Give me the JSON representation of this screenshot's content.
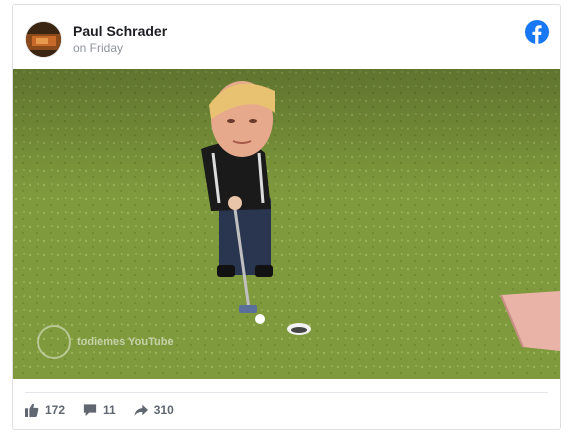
{
  "post": {
    "author": "Paul Schrader",
    "time": "on Friday"
  },
  "icons": {
    "brand": "facebook-logo-icon",
    "like": "thumbs-up-icon",
    "comment": "comment-icon",
    "share": "share-icon"
  },
  "media": {
    "watermark": "todiemes YouTube"
  },
  "stats": {
    "likes": "172",
    "comments": "11",
    "shares": "310"
  },
  "colors": {
    "facebook_blue": "#1877f2",
    "turf_green": "#7f9a3d"
  }
}
